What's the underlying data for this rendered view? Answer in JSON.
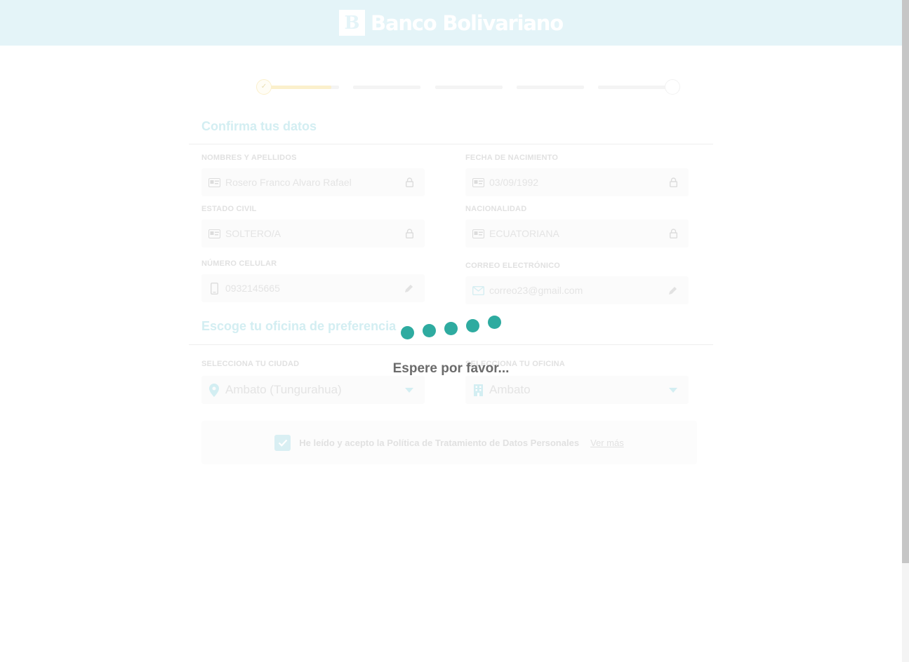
{
  "header": {
    "logo_mark": "B",
    "brand": "Banco Bolivariano"
  },
  "stepper": {
    "progress": [
      0.9,
      0,
      0,
      0,
      0
    ],
    "first_step_icon": "check-icon"
  },
  "personal_section": {
    "title": "Confirma tus datos",
    "fields": {
      "names_label": "NOMBRES Y APELLIDOS",
      "names_value": "Rosero Franco Alvaro Rafael",
      "birthdate_label": "FECHA DE NACIMIENTO",
      "birthdate_value": "03/09/1992",
      "civil_label": "ESTADO CIVIL",
      "civil_value": "SOLTERO/A",
      "nationality_label": "NACIONALIDAD",
      "nationality_value": "ECUATORIANA",
      "phone_label": "NÚMERO CELULAR",
      "phone_value": "0932145665",
      "email_label": "CORREO ELECTRÓNICO",
      "email_value": "correo23@gmail.com"
    }
  },
  "office_section": {
    "title": "Escoge tu oficina de preferencia",
    "city_label": "SELECCIONA TU CIUDAD",
    "city_value": "Ambato (Tungurahua)",
    "office_label": "SELECCIONA TU OFICINA",
    "office_value": "Ambato"
  },
  "consent": {
    "checked": true,
    "text": "He leído y acepto la Política de Tratamiento de Datos Personales",
    "link": "Ver más"
  },
  "loader": {
    "text": "Espere por favor..."
  },
  "colors": {
    "header_bg": "#e4f4f8",
    "loader_dot": "#2eaba0",
    "loader_text": "#6b6b6b",
    "faded_teal": "#d3eef2",
    "faded_yellow": "#fbf0cc"
  }
}
